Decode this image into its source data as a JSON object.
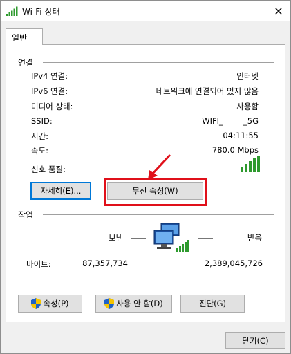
{
  "window": {
    "title": "Wi-Fi 상태",
    "close_symbol": "✕"
  },
  "tabs": [
    {
      "label": "일반"
    }
  ],
  "connection": {
    "header": "연결",
    "rows": [
      {
        "label": "IPv4 연결:",
        "value": "인터넷"
      },
      {
        "label": "IPv6 연결:",
        "value": "네트워크에 연결되어 있지 않음"
      },
      {
        "label": "미디어 상태:",
        "value": "사용함"
      },
      {
        "label": "SSID:",
        "value": "WIFI_        _5G"
      },
      {
        "label": "시간:",
        "value": "04:11:55"
      },
      {
        "label": "속도:",
        "value": "780.0 Mbps"
      }
    ],
    "signal_label": "신호 품질:",
    "signal_bars": 5,
    "details_button": "자세히(E)...",
    "wireless_properties_button": "무선 속성(W)"
  },
  "activity": {
    "header": "작업",
    "sent_label": "보냄",
    "received_label": "받음",
    "bytes_label": "바이트:",
    "bytes_sent": "87,357,734",
    "bytes_received": "2,389,045,726"
  },
  "buttons": {
    "properties": "속성(P)",
    "disable": "사용 안 함(D)",
    "diagnose": "진단(G)",
    "close": "닫기(C)"
  },
  "colors": {
    "highlight": "#e0101a",
    "signal": "#2e9a2e",
    "focus": "#0078d7"
  }
}
